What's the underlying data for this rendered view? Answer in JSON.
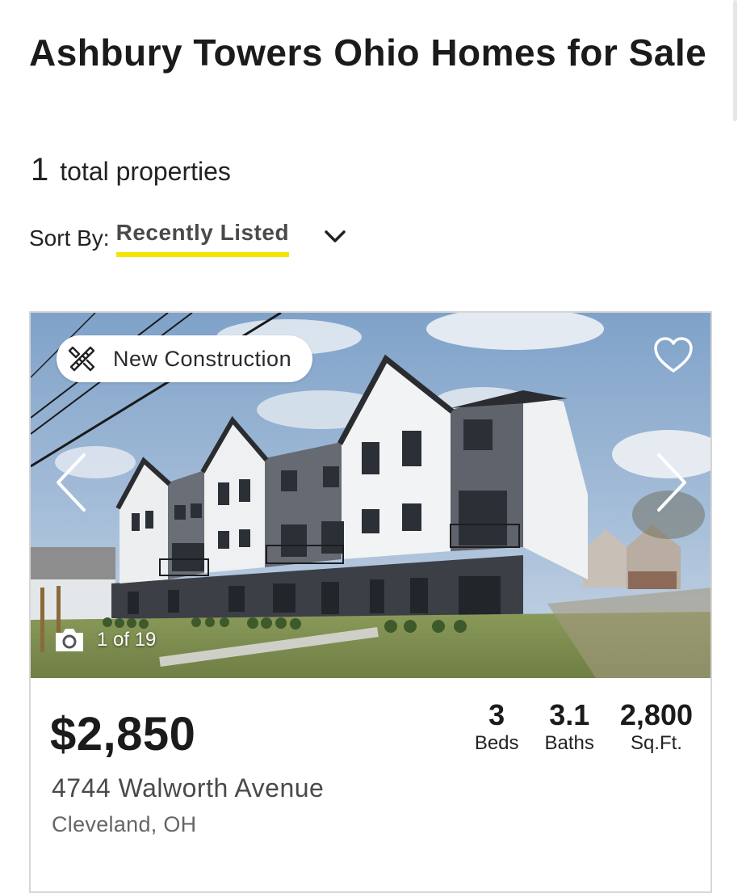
{
  "page": {
    "title": "Ashbury Towers Ohio Homes for Sale",
    "total_count": "1",
    "total_label": "total properties"
  },
  "sort": {
    "label": "Sort By:",
    "value": "Recently Listed",
    "accent_color": "#f4e400"
  },
  "listing": {
    "badge": "New Construction",
    "badge_icon": "tools-icon",
    "photo_counter": "1 of 19",
    "price": "$2,850",
    "address": "4744 Walworth Avenue",
    "city_state": "Cleveland, OH",
    "stats": [
      {
        "value": "3",
        "label": "Beds"
      },
      {
        "value": "3.1",
        "label": "Baths"
      },
      {
        "value": "2,800",
        "label": "Sq.Ft."
      }
    ]
  },
  "icons": {
    "favorite": "heart-outline-icon",
    "prev": "chevron-left-icon",
    "next": "chevron-right-icon",
    "camera": "camera-icon",
    "sort": "chevron-down-icon"
  }
}
